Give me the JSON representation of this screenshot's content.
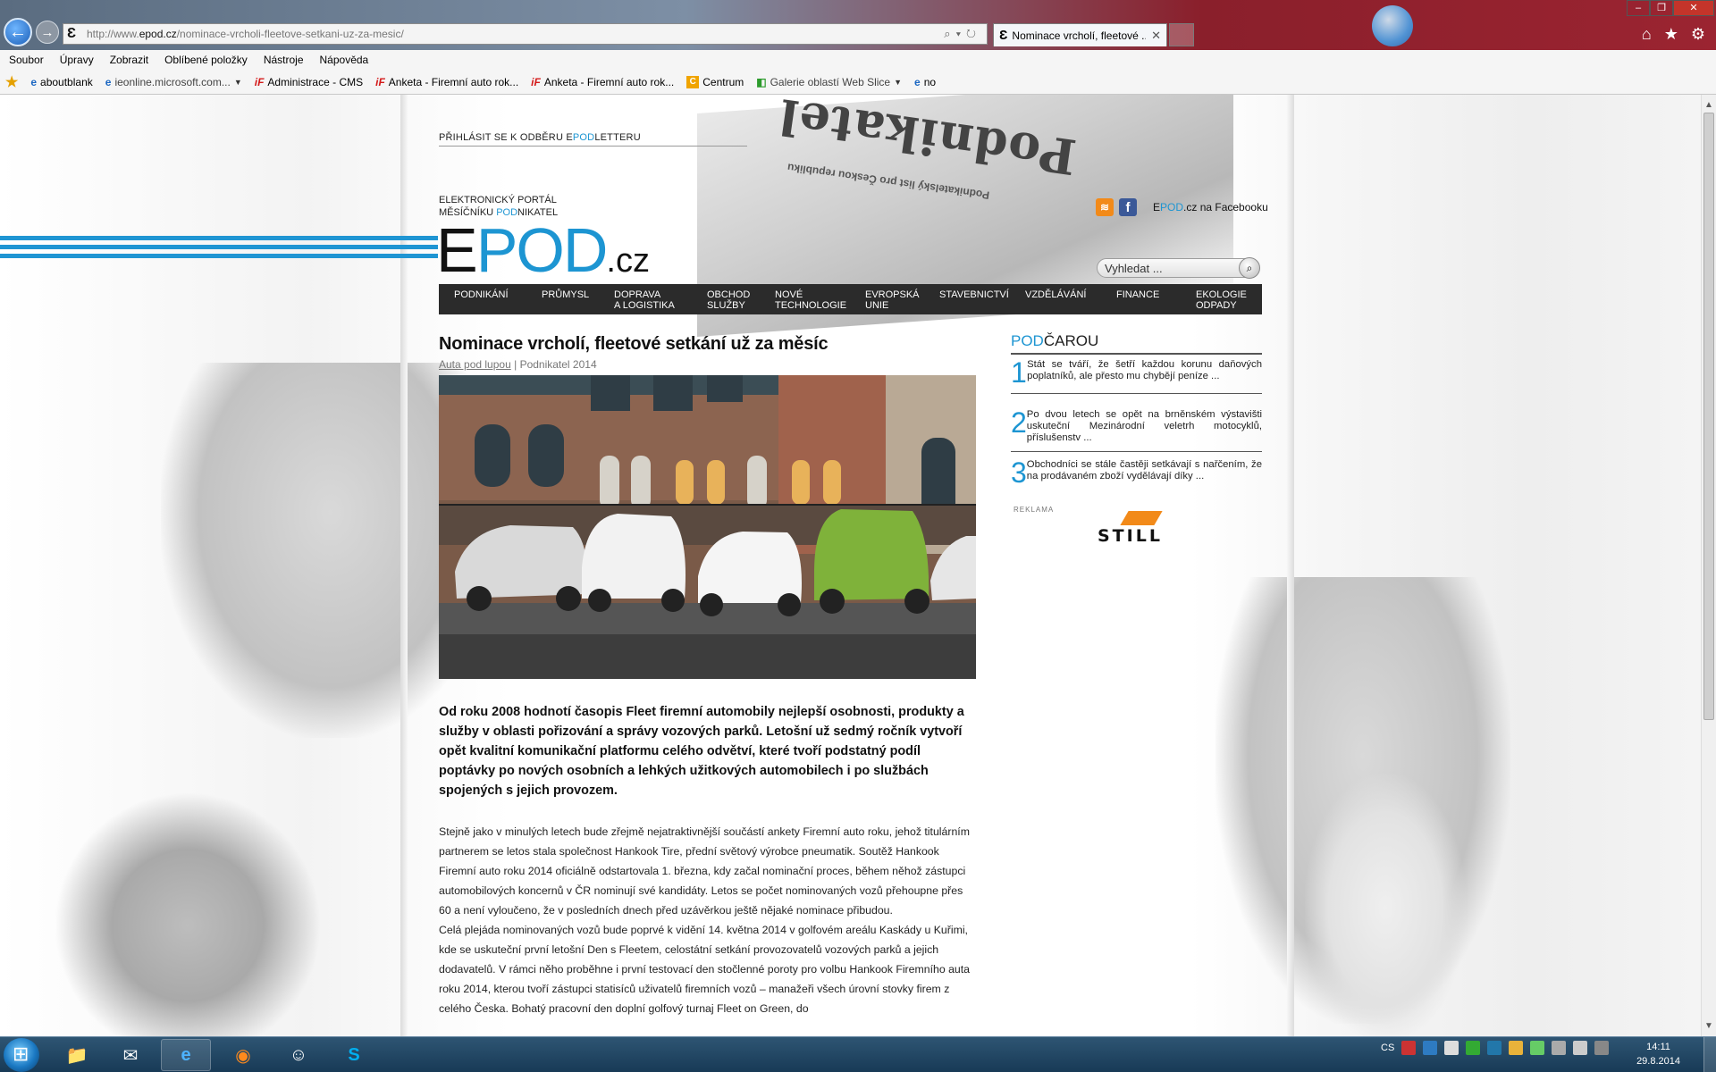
{
  "browser": {
    "url_prefix": "http://www.",
    "url_domain": "epod.cz",
    "url_path": "/nominace-vrcholi-fleetove-setkani-uz-za-mesic/",
    "tab_title": "Nominace vrcholí, fleetové ...",
    "menu": [
      "Soubor",
      "Úpravy",
      "Zobrazit",
      "Oblíbené položky",
      "Nástroje",
      "Nápověda"
    ],
    "favorites": [
      {
        "label": "aboutblank",
        "icon": "ie-page-icon"
      },
      {
        "label": "ieonline.microsoft.com...",
        "icon": "ie-page-icon",
        "dropdown": true
      },
      {
        "label": "Administrace - CMS",
        "icon": "if-logo-icon"
      },
      {
        "label": "Anketa - Firemní auto rok...",
        "icon": "if-logo-icon"
      },
      {
        "label": "Anketa - Firemní auto rok...",
        "icon": "if-logo-icon"
      },
      {
        "label": "Centrum",
        "icon": "centrum-icon"
      },
      {
        "label": "Galerie oblastí Web Slice",
        "icon": "web-slice-icon",
        "dropdown": true
      },
      {
        "label": "no",
        "icon": "ie-page-icon"
      }
    ]
  },
  "site": {
    "subscribe_pre": "PŘIHLÁSIT SE K ODBĚRU E",
    "subscribe_pod": "POD",
    "subscribe_post": "LETTERU",
    "tagline_line1": "ELEKTRONICKÝ PORTÁL",
    "tagline_line2_pre": "MĚSÍČNÍKU ",
    "tagline_line2_pod": "POD",
    "tagline_line2_post": "NIKATEL",
    "logo_e": "E",
    "logo_pod": "POD",
    "logo_cz": ".cz",
    "newspaper_title": "Podnikatel",
    "newspaper_subtitle": "Podnikatelský list pro Českou republiku",
    "facebook_e": "E",
    "facebook_pod": "POD",
    "facebook_rest": ".cz na Facebooku",
    "search_placeholder": "Vyhledat ...",
    "nav": [
      {
        "line1": "PODNIKÁNÍ",
        "line2": ""
      },
      {
        "line1": "PRŮMYSL",
        "line2": ""
      },
      {
        "line1": "DOPRAVA",
        "line2": "A LOGISTIKA"
      },
      {
        "line1": "OBCHOD",
        "line2": "SLUŽBY"
      },
      {
        "line1": "NOVÉ",
        "line2": "TECHNOLOGIE"
      },
      {
        "line1": "EVROPSKÁ",
        "line2": "UNIE"
      },
      {
        "line1": "STAVEBNICTVÍ",
        "line2": ""
      },
      {
        "line1": "VZDĚLÁVÁNÍ",
        "line2": ""
      },
      {
        "line1": "FINANCE",
        "line2": ""
      },
      {
        "line1": "EKOLOGIE",
        "line2": "ODPADY"
      }
    ]
  },
  "article": {
    "title": "Nominace vrcholí, fleetové setkání už za měsíc",
    "category": "Auta pod lupou",
    "separator": "|",
    "source": "Podnikatel 2014",
    "lead": "Od roku 2008 hodnotí časopis Fleet firemní automobily nejlepší osobnosti, produkty a služby v oblasti pořizování a správy vozových parků. Letošní už sedmý ročník vytvoří opět kvalitní komunikační platformu celého odvětví, které tvoří podstatný podíl poptávky po nových osobních a lehkých užitkových automobilech i po službách spojených s jejich provozem.",
    "paragraph1": "Stejně jako v minulých letech bude zřejmě nejatraktivnější součástí ankety Firemní auto roku, jehož titulárním partnerem se letos stala společnost Hankook Tire, přední světový výrobce pneumatik. Soutěž Hankook Firemní auto roku 2014 oficiálně odstartovala 1. března, kdy začal nominační proces, během něhož zástupci automobilových koncernů v ČR nominují své kandidáty. Letos se počet nominovaných vozů přehoupne přes 60 a není vyloučeno, že v posledních dnech před uzávěrkou ještě nějaké nominace přibudou.",
    "paragraph2": "Celá plejáda nominovaných vozů bude poprvé k vidění 14. května 2014 v golfovém areálu Kaskády u Kuřimi, kde se uskuteční první letošní Den s Fleetem, celostátní setkání provozovatelů vozových parků a jejich dodavatelů. V rámci něho proběhne i první testovací den stočlenné poroty pro volbu Hankook Firemního auta roku 2014, kterou tvoří zástupci statisíců uživatelů firemních vozů – manažeři všech úrovní stovky firem z celého Česka. Bohatý pracovní den doplní golfový turnaj Fleet on Green, do"
  },
  "sidebar": {
    "title_pod": "POD",
    "title_rest": "ČAROU",
    "items": [
      {
        "num": "1",
        "text": "Stát se tváří, že šetří každou korunu daňových poplatníků, ale přesto mu chybějí peníze ..."
      },
      {
        "num": "2",
        "text": "Po dvou letech se opět na brněnském výstavišti uskuteční Mezinárodní veletrh motocyklů, příslušenstv ..."
      },
      {
        "num": "3",
        "text": "Obchodníci se stále častěji setkávají s nařčením, že na prodávaném zboží vydělávají díky ..."
      }
    ],
    "ad_label": "REKLAMA",
    "ad_brand": "STILL"
  },
  "taskbar": {
    "language": "CS",
    "time": "14:11",
    "date": "29.8.2014"
  },
  "colors": {
    "brand_blue": "#1d95d2",
    "nav_background": "#2b2b2b",
    "still_orange": "#f28a19"
  }
}
